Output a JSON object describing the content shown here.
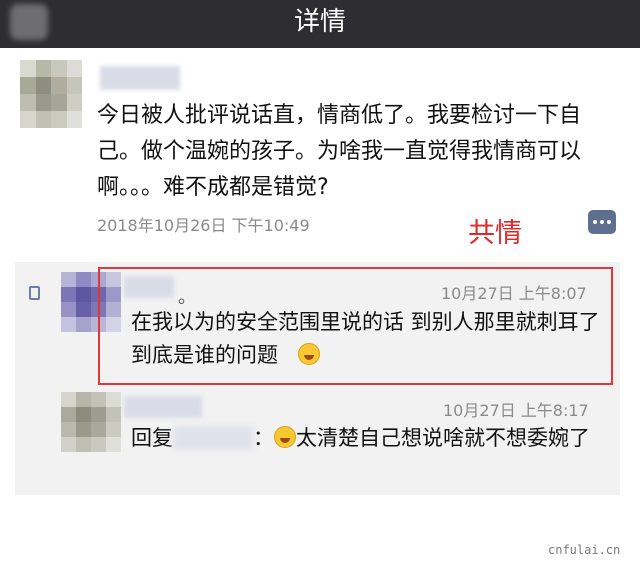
{
  "header": {
    "title": "详情"
  },
  "post": {
    "text": "今日被人批评说话直，情商低了。我要检讨一下自己。做个温婉的孩子。为啥我一直觉得我情商可以啊。。。难不成都是错觉?",
    "timestamp": "2018年10月26日 下午10:49",
    "annotation": "共情"
  },
  "comments": [
    {
      "suffix": "。",
      "time": "10月27日 上午8:07",
      "text": "在我以为的安全范围里说的话 到别人那里就刺耳了 到底是谁的问题"
    },
    {
      "time": "10月27日 上午8:17",
      "reply_prefix": "回复",
      "reply_colon": "：",
      "text": "太清楚自己想说啥就不想委婉了"
    }
  ],
  "watermark": "cnfulai.cn",
  "colors": {
    "header_bg": "#2e2e32",
    "annotation_red": "#e02828",
    "comments_bg": "#f2f2f3",
    "link_blue": "#5f6f90"
  },
  "icons": {
    "comment": "comment-icon",
    "like": "like-icon",
    "emoji_grin": "grinning-emoji",
    "emoji_laugh": "laughing-emoji"
  }
}
